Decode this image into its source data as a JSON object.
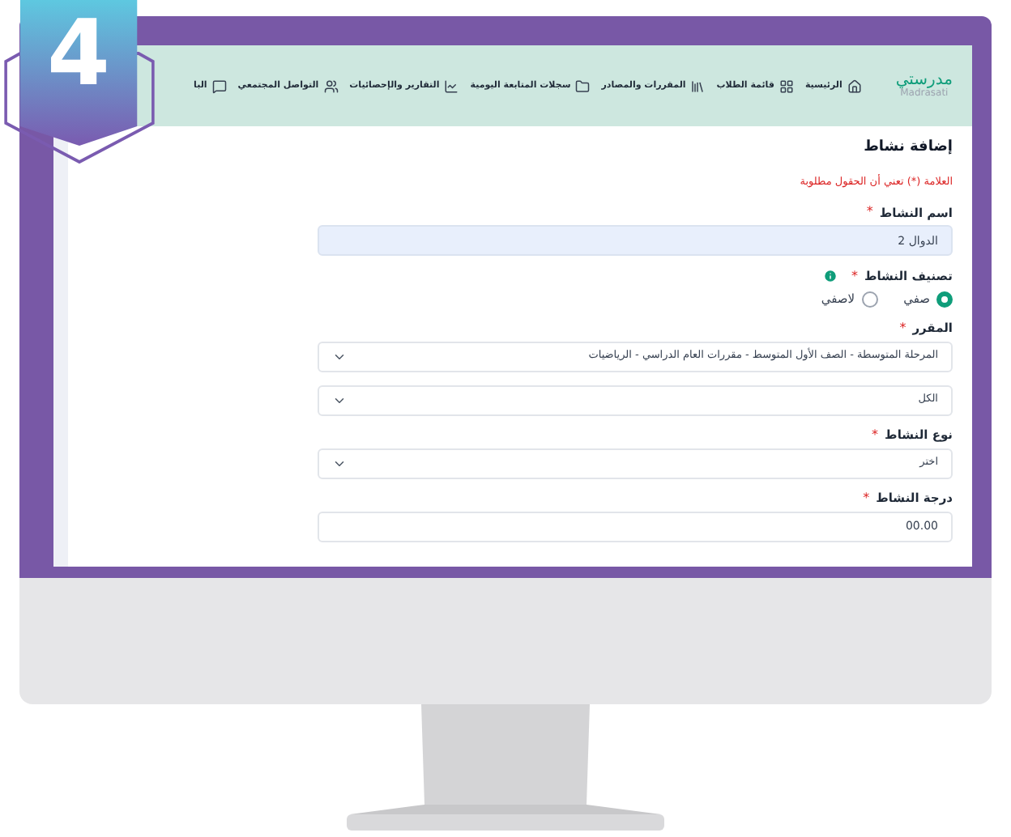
{
  "step_badge": "4",
  "logo": {
    "name": "مدرستي",
    "latin": "Madrasati"
  },
  "nav": [
    {
      "label": "الرئيسية"
    },
    {
      "label": "قائمة الطلاب"
    },
    {
      "label": "المقررات والمصادر"
    },
    {
      "label": "سجلات المتابعة اليومية"
    },
    {
      "label": "التقارير والإحصائيات"
    },
    {
      "label": "التواصل المجتمعي"
    },
    {
      "label": "البا"
    }
  ],
  "form": {
    "title": "إضافة نشاط",
    "required_note": "العلامة (*) تعني أن الحقول مطلوبة",
    "fields": [
      {
        "kind": "text",
        "label": "اسم النشاط",
        "mark": "*",
        "value": "الدوال 2"
      },
      {
        "kind": "radio",
        "label": "تصنيف النشاط",
        "mark": "*",
        "info": true,
        "options": [
          {
            "label": "صفي",
            "selected": true
          },
          {
            "label": "لاصفي",
            "selected": false
          }
        ]
      },
      {
        "kind": "select",
        "label": "المقرر",
        "mark": "*",
        "value": "المرحلة المتوسطة - الصف الأول المتوسط - مقررات العام الدراسي - الرياضيات"
      },
      {
        "kind": "select",
        "value": "الكل"
      },
      {
        "kind": "select",
        "label": "نوع النشاط",
        "mark": "*",
        "value": "اختر"
      },
      {
        "kind": "text",
        "label": "درجة النشاط",
        "mark": "*",
        "value": "00.00"
      }
    ]
  }
}
